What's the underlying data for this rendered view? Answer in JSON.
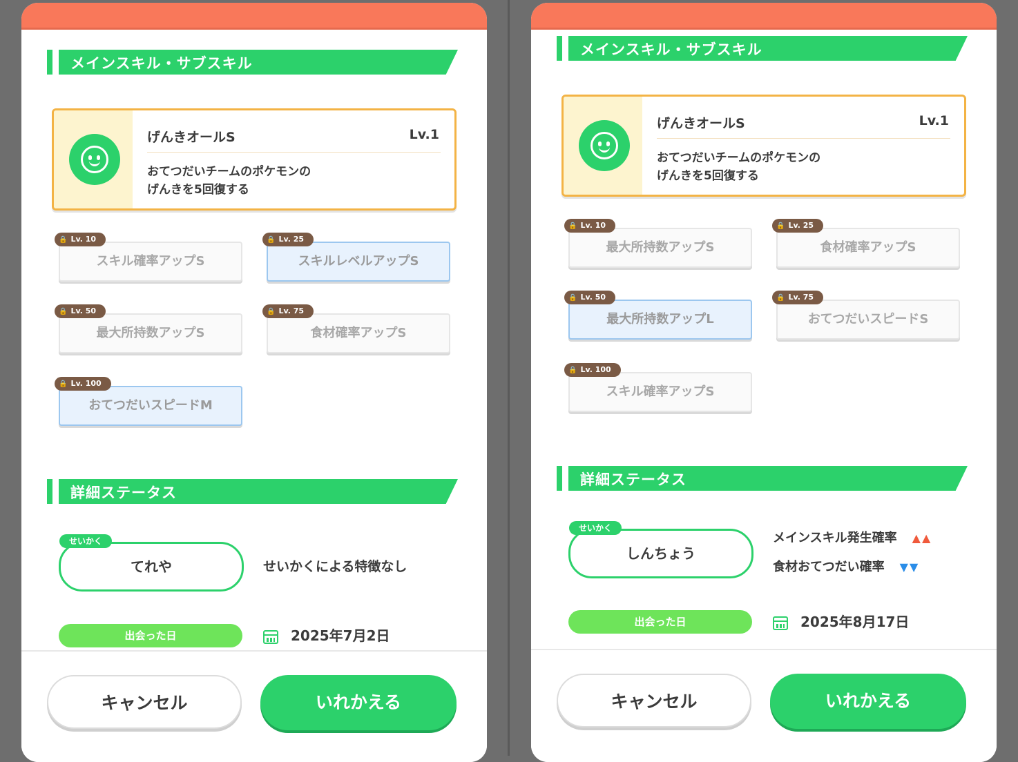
{
  "left": {
    "section_skills": "メインスキル・サブスキル",
    "main_skill": {
      "name": "げんきオールS",
      "level": "Lv.1",
      "desc_line1": "おてつだいチームのポケモンの",
      "desc_line2": "げんきを5回復する"
    },
    "subskills": [
      {
        "level": "Lv. 10",
        "name": "スキル確率アップS"
      },
      {
        "level": "Lv. 25",
        "name": "スキルレベルアップS"
      },
      {
        "level": "Lv. 50",
        "name": "最大所持数アップS"
      },
      {
        "level": "Lv. 75",
        "name": "食材確率アップS"
      },
      {
        "level": "Lv. 100",
        "name": "おてつだいスピードM"
      }
    ],
    "section_status": "詳細ステータス",
    "nature_tag": "せいかく",
    "nature": "てれや",
    "nature_effect": "せいかくによる特徴なし",
    "met_label": "出会った日",
    "met_date": "2025年7月2日",
    "cancel": "キャンセル",
    "swap": "いれかえる"
  },
  "right": {
    "section_skills": "メインスキル・サブスキル",
    "main_skill": {
      "name": "げんきオールS",
      "level": "Lv.1",
      "desc_line1": "おてつだいチームのポケモンの",
      "desc_line2": "げんきを5回復する"
    },
    "subskills": [
      {
        "level": "Lv. 10",
        "name": "最大所持数アップS"
      },
      {
        "level": "Lv. 25",
        "name": "食材確率アップS"
      },
      {
        "level": "Lv. 50",
        "name": "最大所持数アップL"
      },
      {
        "level": "Lv. 75",
        "name": "おてつだいスピードS"
      },
      {
        "level": "Lv. 100",
        "name": "スキル確率アップS"
      }
    ],
    "section_status": "詳細ステータス",
    "nature_tag": "せいかく",
    "nature": "しんちょう",
    "effect_up": "メインスキル発生確率",
    "effect_down": "食材おてつだい確率",
    "up_arrows": "▲▲",
    "down_arrows": "▼▼",
    "met_label": "出会った日",
    "met_date": "2025年8月17日",
    "cancel": "キャンセル",
    "swap": "いれかえる"
  },
  "colors": {
    "accent": "#2cd16b",
    "topbar": "#f9785a",
    "card_border": "#f3b345",
    "tag": "#7a5a45",
    "highlight": "#e8f2fd"
  },
  "icons": {
    "skill": "smiley-icon",
    "lock": "lock-icon",
    "calendar": "calendar-icon"
  }
}
